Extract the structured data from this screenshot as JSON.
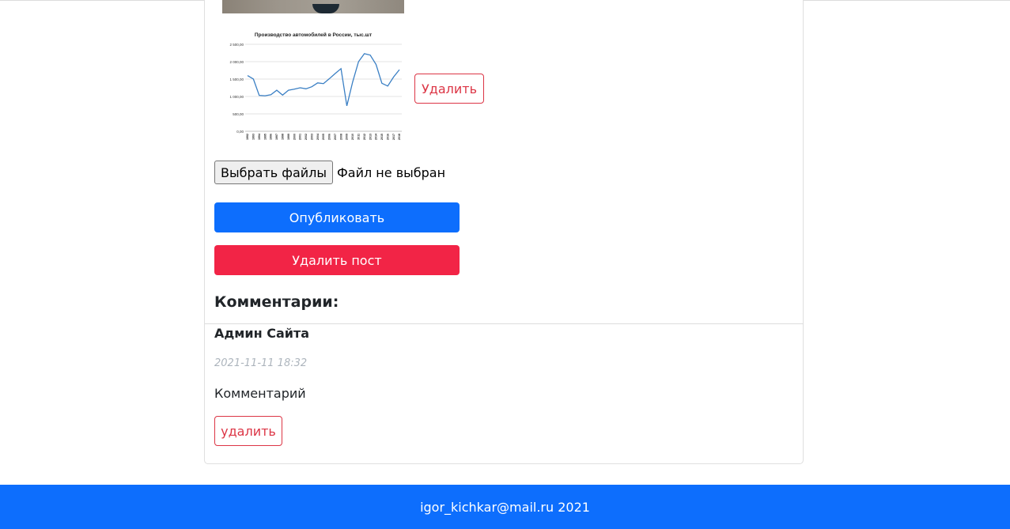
{
  "post": {
    "image_remove_label": "Удалить",
    "file_input": {
      "button_label": "Выбрать файлы",
      "status": "Файл не выбран"
    },
    "publish_label": "Опубликовать",
    "delete_post_label": "Удалить пост"
  },
  "chart_image": {
    "chart_data": {
      "type": "line",
      "title": "Производство автомобилей в России, тыс.шт",
      "ytick_labels": [
        "2 500,00",
        "2 000,00",
        "1 500,00",
        "1 000,00",
        "500,00",
        "0,00"
      ],
      "ylim": [
        0,
        2500
      ],
      "categories": [
        "1992",
        "1993",
        "1994",
        "1995",
        "1996",
        "1997",
        "1998",
        "1999",
        "2000",
        "2001",
        "2002",
        "2003",
        "2004",
        "2005",
        "2006",
        "2007",
        "2008",
        "2009",
        "2010",
        "2011",
        "2012",
        "2013",
        "2014",
        "2015",
        "2016",
        "2017",
        "2018"
      ],
      "values": [
        1600,
        1500,
        1030,
        1020,
        1050,
        1180,
        1040,
        1180,
        1210,
        1250,
        1220,
        1280,
        1390,
        1370,
        1510,
        1660,
        1800,
        730,
        1420,
        2000,
        2230,
        2190,
        1920,
        1380,
        1300,
        1560,
        1770
      ],
      "xlabel": "",
      "ylabel": "",
      "grid": true,
      "color": "#3a7fc4"
    }
  },
  "comments": {
    "heading": "Комментарии:",
    "items": [
      {
        "author": "Админ Сайта",
        "date": "2021-11-11 18:32",
        "text": "Комментарий",
        "delete_label": "удалить"
      }
    ]
  },
  "footer": {
    "text": "igor_kichkar@mail.ru 2021"
  },
  "colors": {
    "primary": "#0d6efd",
    "danger": "#dc3545",
    "danger_solid": "#f22446",
    "muted": "#adb5bd"
  }
}
